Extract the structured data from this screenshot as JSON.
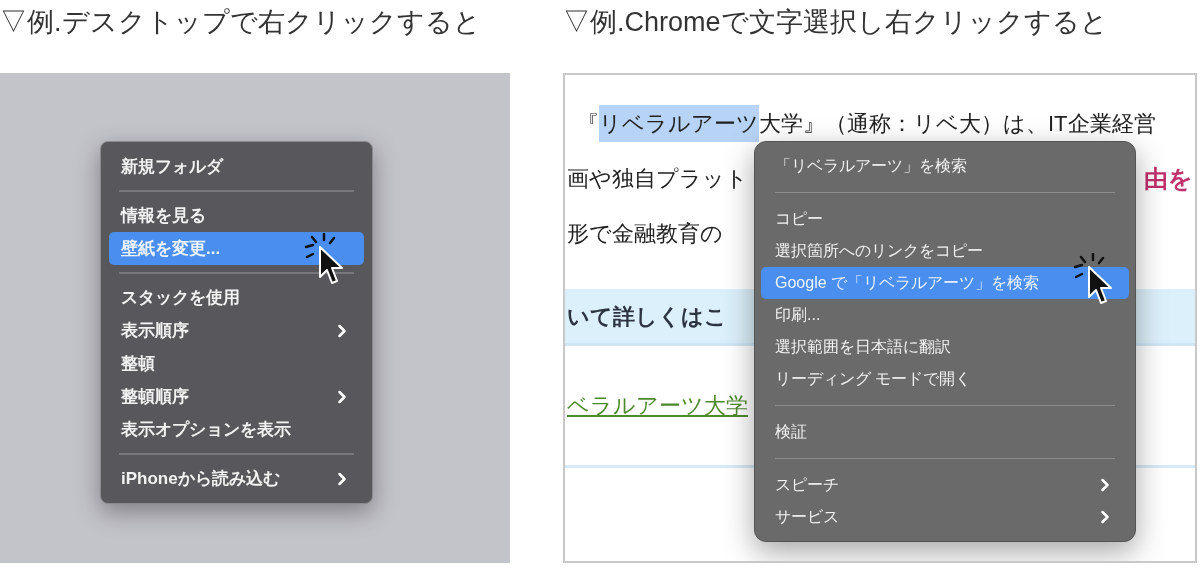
{
  "headings": [
    "▽例.デスクトップで右クリックすると",
    "▽例.Chromeで文字選択し右クリックすると"
  ],
  "desktop": {
    "menu": [
      {
        "kind": "item",
        "label": "新規フォルダ",
        "selected": false,
        "submenu": false
      },
      {
        "kind": "separator"
      },
      {
        "kind": "item",
        "label": "情報を見る",
        "selected": false,
        "submenu": false
      },
      {
        "kind": "item",
        "label": "壁紙を変更...",
        "selected": true,
        "submenu": false
      },
      {
        "kind": "separator"
      },
      {
        "kind": "item",
        "label": "スタックを使用",
        "selected": false,
        "submenu": false
      },
      {
        "kind": "item",
        "label": "表示順序",
        "selected": false,
        "submenu": true
      },
      {
        "kind": "item",
        "label": "整頓",
        "selected": false,
        "submenu": false
      },
      {
        "kind": "item",
        "label": "整頓順序",
        "selected": false,
        "submenu": true
      },
      {
        "kind": "item",
        "label": "表示オプションを表示",
        "selected": false,
        "submenu": false
      },
      {
        "kind": "separator"
      },
      {
        "kind": "item",
        "label": "iPhoneから読み込む",
        "selected": false,
        "submenu": true
      }
    ]
  },
  "browser": {
    "page": {
      "first_line": {
        "before": "『",
        "selection": "リベラルアーツ",
        "after": "大学』（通称：リベ大）は、IT企業経営"
      },
      "line_2_left": "画や独自プラット",
      "line_2_right": "由を",
      "line_3": "形で金融教育の",
      "banner": "いて詳しくはこ",
      "link": "ベラルアーツ大学"
    },
    "menu": [
      {
        "kind": "item",
        "label": "「リベラルアーツ」を検索",
        "selected": false,
        "submenu": false
      },
      {
        "kind": "separator"
      },
      {
        "kind": "item",
        "label": "コピー",
        "selected": false,
        "submenu": false
      },
      {
        "kind": "item",
        "label": "選択箇所へのリンクをコピー",
        "selected": false,
        "submenu": false
      },
      {
        "kind": "item",
        "label": "Google で「リベラルアーツ」を検索",
        "selected": true,
        "submenu": false
      },
      {
        "kind": "item",
        "label": "印刷...",
        "selected": false,
        "submenu": false
      },
      {
        "kind": "item",
        "label": "選択範囲を日本語に翻訳",
        "selected": false,
        "submenu": false
      },
      {
        "kind": "item",
        "label": "リーディング モードで開く",
        "selected": false,
        "submenu": false
      },
      {
        "kind": "separator"
      },
      {
        "kind": "item",
        "label": "検証",
        "selected": false,
        "submenu": false
      },
      {
        "kind": "separator"
      },
      {
        "kind": "item",
        "label": "スピーチ",
        "selected": false,
        "submenu": true
      },
      {
        "kind": "item",
        "label": "サービス",
        "selected": false,
        "submenu": true
      }
    ]
  }
}
